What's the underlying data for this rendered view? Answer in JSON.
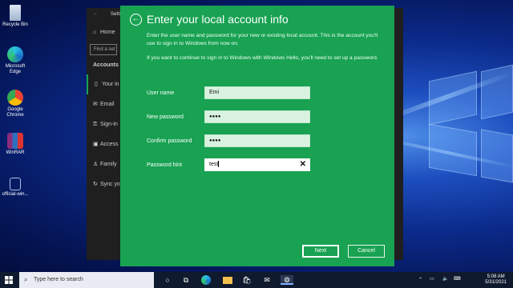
{
  "desktop_icons": [
    {
      "label": "Recycle Bin",
      "icon": "recycle-bin-icon"
    },
    {
      "label": "Microsoft Edge",
      "icon": "edge-icon"
    },
    {
      "label": "Google Chrome",
      "icon": "chrome-icon"
    },
    {
      "label": "WinRAR",
      "icon": "winrar-icon"
    },
    {
      "label": "official-win...",
      "icon": "file-icon"
    }
  ],
  "settings": {
    "title": "Setti",
    "home": "Home",
    "search_placeholder": "Find a set",
    "section": "Accounts",
    "items": [
      "Your in",
      "Email",
      "Sign-in",
      "Access",
      "Family",
      "Sync yo"
    ]
  },
  "dialog": {
    "title": "Enter your local account info",
    "desc1": "Enter the user name and password for your new or existing local account. This is the account you'll use to sign in to Windows from now on.",
    "desc2": "If you want to continue to sign in to Windows with Windows Hello, you'll need to set up a password.",
    "fields": [
      {
        "label": "User name",
        "value": "Emi"
      },
      {
        "label": "New password",
        "value": "●●●●"
      },
      {
        "label": "Confirm password",
        "value": "●●●●"
      },
      {
        "label": "Password hint",
        "value": "test"
      }
    ],
    "next": "Next",
    "cancel": "Cancel",
    "accent": "#18a252"
  },
  "taskbar": {
    "search_placeholder": "Type here to search",
    "time": "5:08 AM",
    "date": "5/31/2021"
  }
}
